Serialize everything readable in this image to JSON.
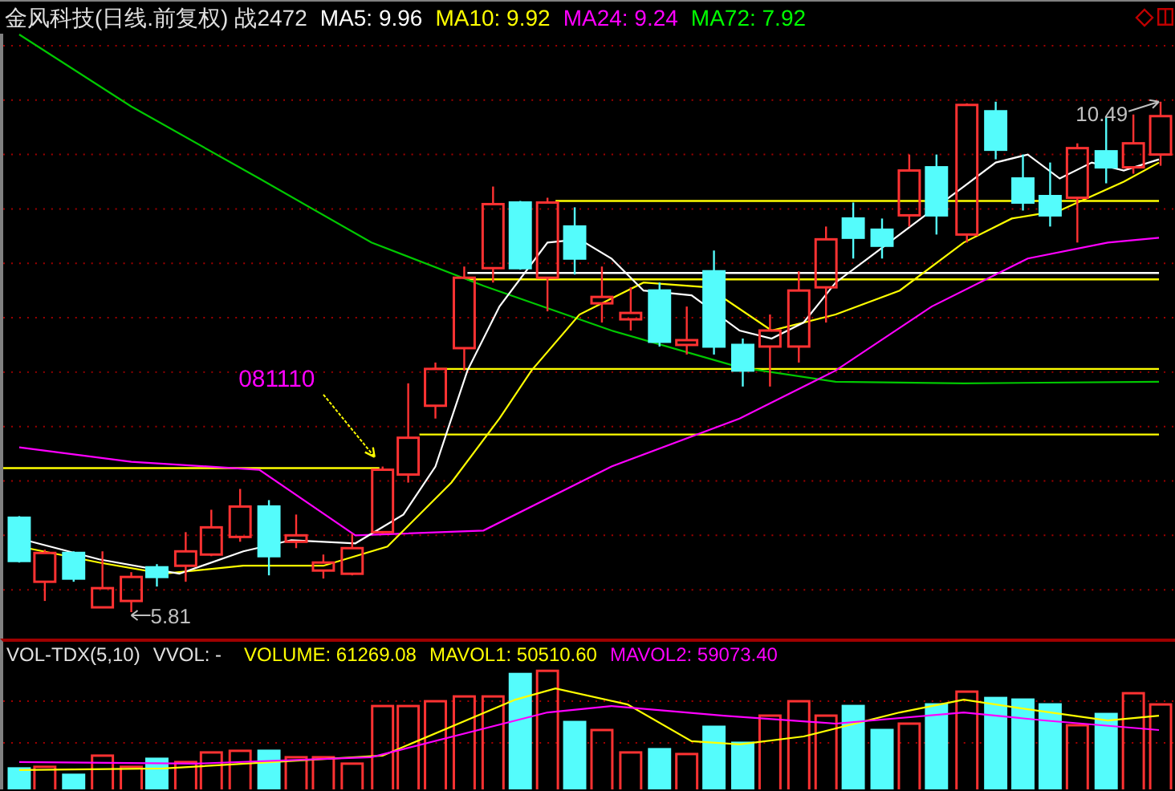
{
  "chart": {
    "title": "金风科技(日线.前复权)",
    "code": "战2472",
    "indicators": [
      {
        "text": "MA5: 9.96",
        "color": "#ffffff"
      },
      {
        "text": "MA10: 9.92",
        "color": "#ffff00"
      },
      {
        "text": "MA24: 9.24",
        "color": "#ff00ff"
      },
      {
        "text": "MA72: 7.92",
        "color": "#00ff00"
      }
    ]
  },
  "annotations": {
    "signal_date": "081110",
    "low_price": "5.81",
    "high_price": "10.49"
  },
  "volume": {
    "title": "VOL-TDX(5,10)",
    "vvol": "VVOL: -",
    "indicators": [
      {
        "text": "VOLUME: 61269.08",
        "color": "#ffff00"
      },
      {
        "text": "MAVOL1: 50510.60",
        "color": "#ffff00"
      },
      {
        "text": "MAVOL2: 59073.40",
        "color": "#ff00ff"
      }
    ]
  }
}
